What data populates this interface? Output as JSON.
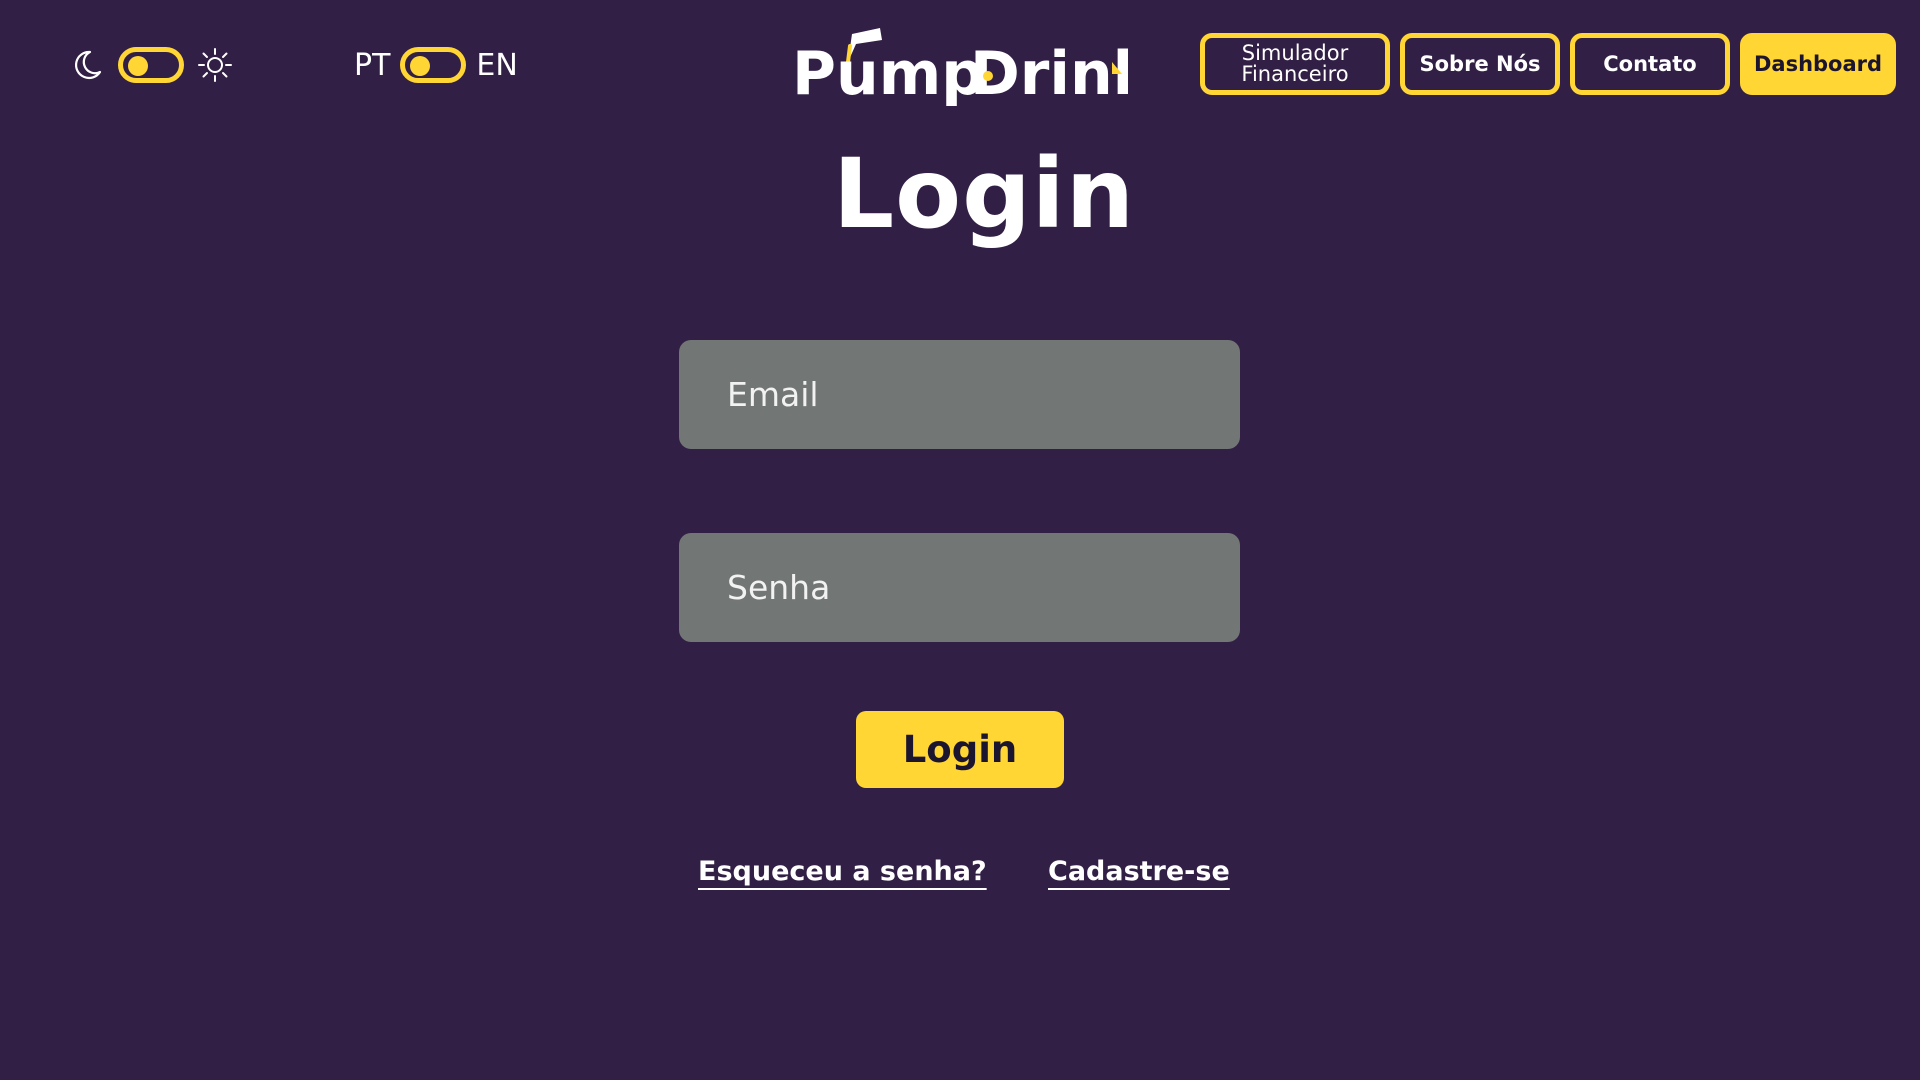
{
  "header": {
    "theme_toggle": {
      "left_icon": "moon-icon",
      "right_icon": "sun-icon",
      "state": "left"
    },
    "lang_toggle": {
      "left_label": "PT",
      "right_label": "EN",
      "state": "left"
    },
    "logo": {
      "text_part1": "Pump",
      "text_part2": "Drink"
    },
    "nav": {
      "simulador_label": "Simulador\nFinanceiro",
      "sobre_label": "Sobre Nós",
      "contato_label": "Contato",
      "dashboard_label": "Dashboard"
    }
  },
  "main": {
    "title": "Login",
    "email_placeholder": "Email",
    "password_placeholder": "Senha",
    "login_button_label": "Login",
    "forgot_link": "Esqueceu a senha?",
    "signup_link": "Cadastre-se"
  },
  "colors": {
    "background": "#311f45",
    "accent": "#ffd633",
    "input_bg": "#727675"
  }
}
